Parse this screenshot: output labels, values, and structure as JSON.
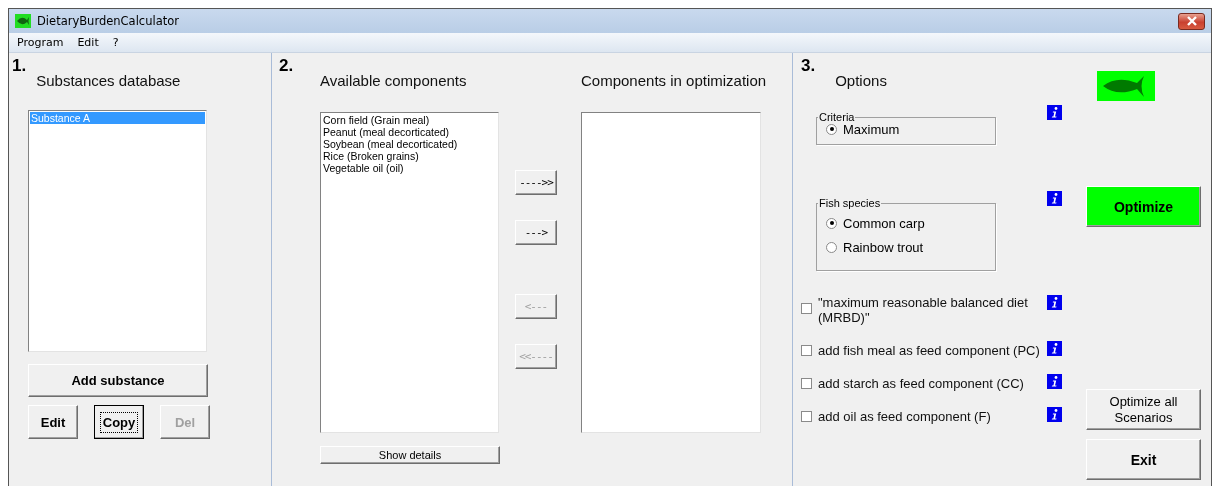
{
  "window": {
    "title": "DietaryBurdenCalculator"
  },
  "menu": [
    "Program",
    "Edit",
    "?"
  ],
  "substances": {
    "number": "1.",
    "title": "Substances database",
    "items": [
      {
        "label": "Substance A",
        "selected": true
      }
    ],
    "add_button": {
      "label": "Add substance",
      "disabled": false,
      "focused": false
    },
    "buttons": [
      {
        "label": "Edit",
        "disabled": false,
        "focused": false
      },
      {
        "label": "Copy",
        "disabled": false,
        "focused": true
      },
      {
        "label": "Del",
        "disabled": true,
        "focused": false
      }
    ]
  },
  "components": {
    "number": "2.",
    "available_title": "Available components",
    "optimization_title": "Components in optimization",
    "available": [
      "Corn field (Grain meal)",
      "Peanut (meal decorticated)",
      "Soybean (meal decorticated)",
      "Rice (Broken grains)",
      "Vegetable oil (oil)"
    ],
    "transfer_buttons": [
      {
        "label": "---->>",
        "disabled": false
      },
      {
        "label": "--->",
        "disabled": false
      },
      {
        "label": "<---",
        "disabled": true
      },
      {
        "label": "<<----",
        "disabled": true
      }
    ],
    "details_button": "Show details"
  },
  "options": {
    "number": "3.",
    "title": "Options",
    "criteria": {
      "label": "Criteria",
      "options": [
        {
          "label": "Maximum",
          "selected": true
        }
      ]
    },
    "fish_species": {
      "label": "Fish species",
      "options": [
        {
          "label": "Common carp",
          "selected": true
        },
        {
          "label": "Rainbow trout",
          "selected": false
        }
      ]
    },
    "checkboxes": [
      {
        "label": "\"maximum reasonable balanced diet (MRBD)\"",
        "checked": false
      },
      {
        "label": "add fish meal as feed component (PC)",
        "checked": false
      },
      {
        "label": "add starch as feed component (CC)",
        "checked": false
      },
      {
        "label": "add oil as feed component (F)",
        "checked": false
      }
    ],
    "actions": [
      {
        "label": "Optimize",
        "kind": "highlight"
      },
      {
        "label": "Optimize all Scenarios",
        "kind": "normal"
      },
      {
        "label": "Exit",
        "kind": "normal"
      }
    ]
  }
}
